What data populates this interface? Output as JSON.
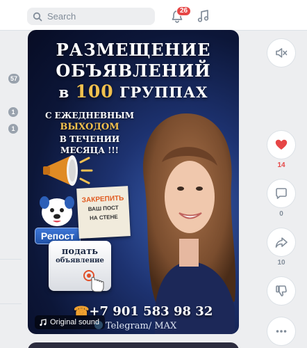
{
  "header": {
    "search_placeholder": "Search",
    "notifications_count": "26"
  },
  "left_counters": [
    "57",
    "1",
    "1"
  ],
  "post": {
    "title_line1": "РАЗМЕЩЕНИЕ",
    "title_line2": "ОБЪЯВЛЕНИЙ",
    "title_line3_pre": "в ",
    "title_line3_num": "100",
    "title_line3_post": " ГРУППАХ",
    "sub_line1": "С ЕЖЕДНЕВНЫМ",
    "sub_line2": "ВЫХОДОМ",
    "sub_line3": "В ТЕЧЕНИИ МЕСЯЦА !!!",
    "note_line1": "ЗАКРЕПИТЬ",
    "note_line2": "ВАШ ПОСТ",
    "note_line3": "НА СТЕНЕ",
    "repost_label": "Репост",
    "cta_line1": "подать",
    "cta_line2": "объявление",
    "phone": "+7 901 583 98 32",
    "telegram": "Telegram/ MAX",
    "sound_label": "Original sound"
  },
  "actions": {
    "likes": "14",
    "comments": "0",
    "shares": "10"
  },
  "colors": {
    "accent_red": "#e64646",
    "gold": "#f2c14e",
    "muted": "#818c99"
  }
}
